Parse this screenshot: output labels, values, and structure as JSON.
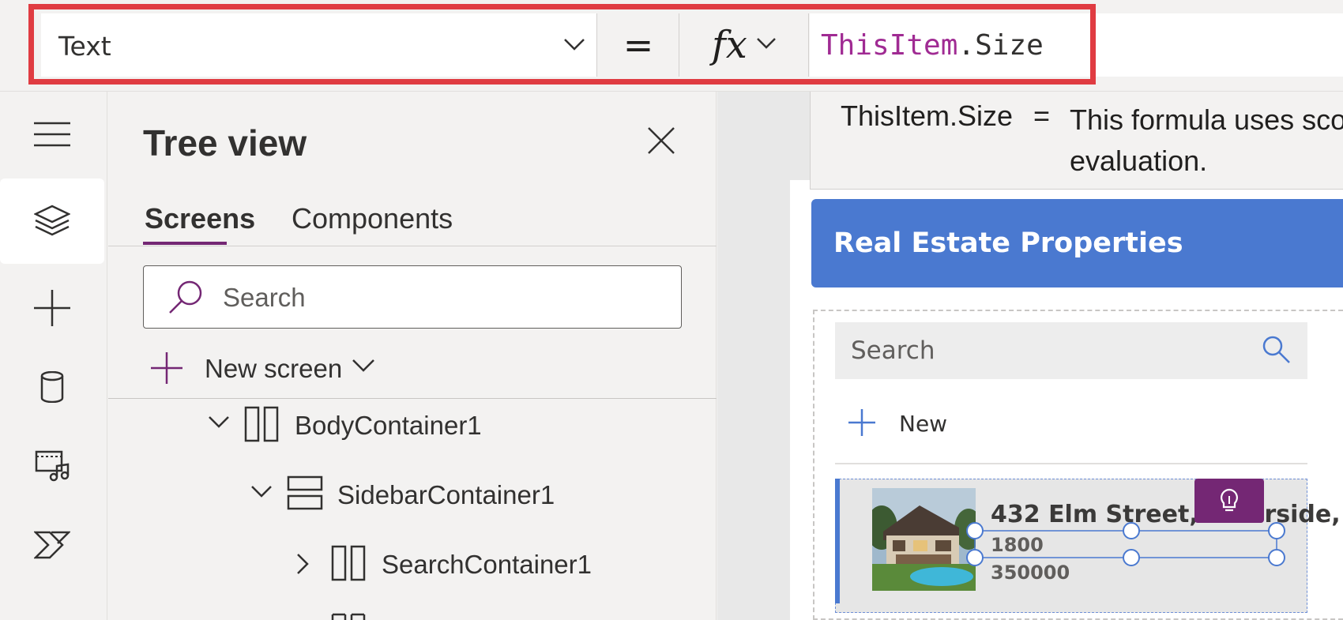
{
  "formula_bar": {
    "property": "Text",
    "equals": "=",
    "fx_label": "fx",
    "formula_keyword": "ThisItem",
    "formula_rest": ".Size"
  },
  "tooltip": {
    "expression": "ThisItem.Size",
    "equals": "=",
    "description": "This formula uses scope evaluation."
  },
  "left_rail": {
    "items": [
      {
        "icon": "hamburger-menu-icon"
      },
      {
        "icon": "layers-icon",
        "active": true
      },
      {
        "icon": "plus-icon"
      },
      {
        "icon": "database-icon"
      },
      {
        "icon": "media-icon"
      },
      {
        "icon": "power-automate-icon"
      }
    ]
  },
  "tree_view": {
    "title": "Tree view",
    "tabs": [
      "Screens",
      "Components"
    ],
    "search_placeholder": "Search",
    "new_screen_label": "New screen",
    "nodes": [
      {
        "label": "BodyContainer1",
        "type": "horizontal-container",
        "expanded": true
      },
      {
        "label": "SidebarContainer1",
        "type": "vertical-container",
        "expanded": true
      },
      {
        "label": "SearchContainer1",
        "type": "horizontal-container",
        "expanded": false
      }
    ]
  },
  "app": {
    "header_title": "Real Estate Properties",
    "search_placeholder": "Search",
    "new_label": "New",
    "item": {
      "address": "432 Elm Street, Riverside,",
      "size": "1800",
      "price": "350000"
    }
  },
  "colors": {
    "highlight": "#e03c42",
    "accent_purple": "#742774",
    "header_blue": "#4a79d0",
    "keyword_purple": "#a02b93"
  }
}
